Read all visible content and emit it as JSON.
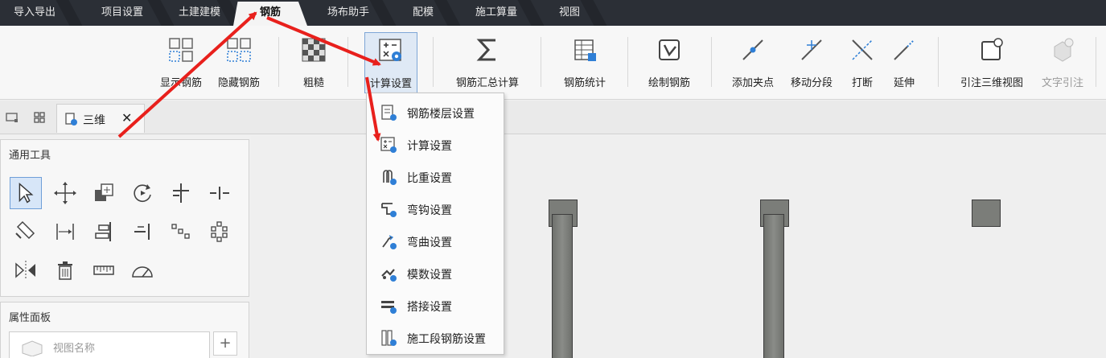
{
  "tabs": [
    "导入导出",
    "项目设置",
    "土建建模",
    "钢筋",
    "场布助手",
    "配模",
    "施工算量",
    "视图"
  ],
  "ribbon": {
    "show_rebar": "显示钢筋",
    "hide_rebar": "隐藏钢筋",
    "rough": "粗糙",
    "calc_settings": "计算设置",
    "rebar_summary": "钢筋汇总计算",
    "rebar_stats": "钢筋统计",
    "draw_rebar": "绘制钢筋",
    "add_point": "添加夹点",
    "move_segment": "移动分段",
    "break": "打断",
    "extend": "延伸",
    "annotate_3d": "引注三维视图",
    "text_annotate": "文字引注"
  },
  "doc_tab": {
    "label": "三维",
    "close": "✕"
  },
  "tools_panel": {
    "title": "通用工具"
  },
  "props_panel": {
    "title": "属性面板",
    "view_name_placeholder": "视图名称",
    "add": "+"
  },
  "menu": {
    "items": [
      "钢筋楼层设置",
      "计算设置",
      "比重设置",
      "弯钩设置",
      "弯曲设置",
      "模数设置",
      "搭接设置",
      "施工段钢筋设置"
    ]
  },
  "colors": {
    "arrow": "#e8201c",
    "accent": "#2f7fd6",
    "tabbar": "#2b2f36"
  }
}
